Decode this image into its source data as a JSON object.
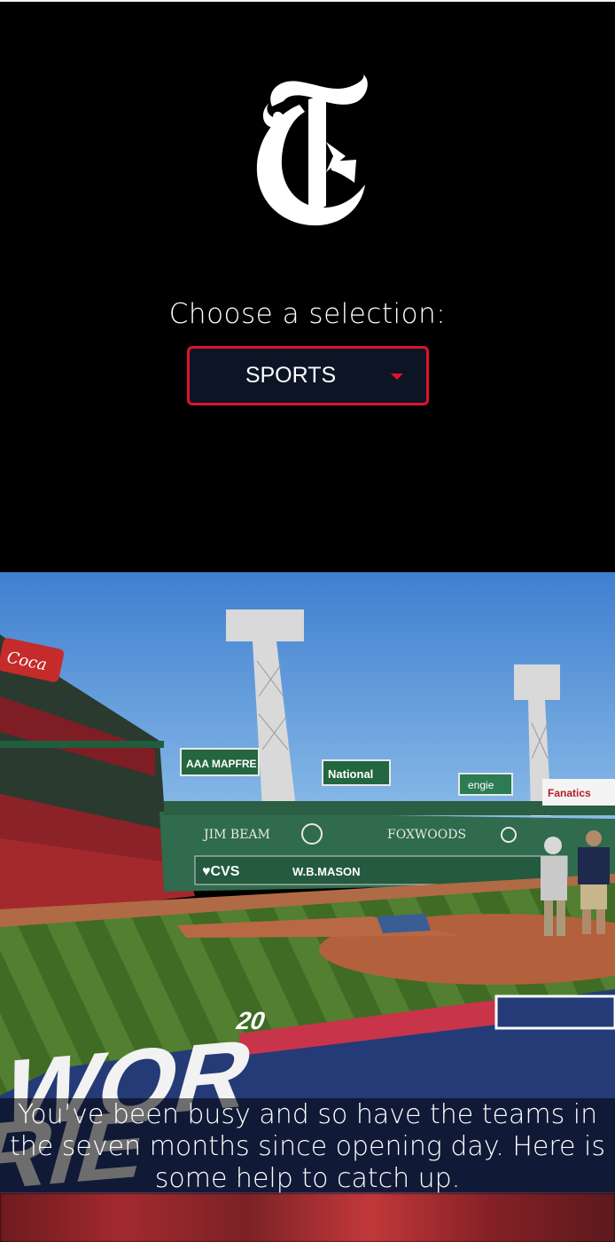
{
  "header": {
    "logo_icon": "nyt-t-logo-icon",
    "prompt": "Choose a selection:",
    "select": {
      "value": "SPORTS",
      "icon": "caret-down-icon",
      "accent": "#e0122a"
    }
  },
  "hero": {
    "image": "baseball-stadium-photo",
    "caption": "You’ve been busy and so have the teams in the seven months since opening day. Here is some help to catch up."
  },
  "colors": {
    "background": "#000000",
    "select_bg": "#0b1526",
    "accent": "#e0122a"
  }
}
